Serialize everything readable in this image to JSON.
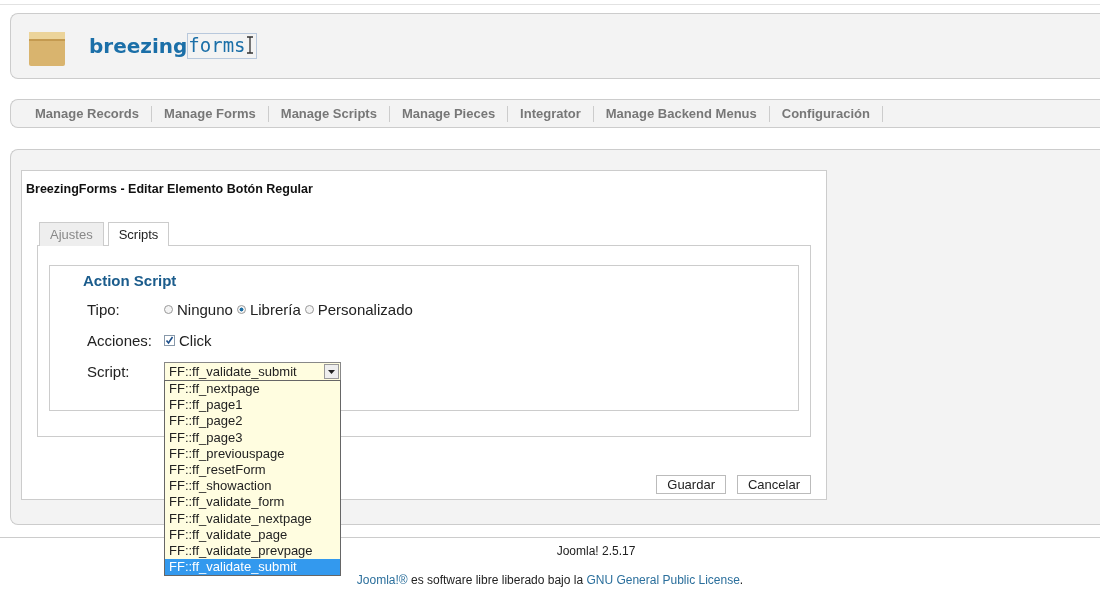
{
  "logo": {
    "bold": "breezing",
    "light": "forms"
  },
  "menu": [
    "Manage Records",
    "Manage Forms",
    "Manage Scripts",
    "Manage Pieces",
    "Integrator",
    "Manage Backend Menus",
    "Configuración"
  ],
  "card": {
    "title": "BreezingForms - Editar Elemento Botón Regular",
    "tabs": [
      {
        "label": "Ajustes",
        "selected": false
      },
      {
        "label": "Scripts",
        "selected": true
      }
    ],
    "legend": "Action Script",
    "tipo": {
      "label": "Tipo:",
      "options": [
        {
          "label": "Ninguno",
          "selected": false
        },
        {
          "label": "Librería",
          "selected": true
        },
        {
          "label": "Personalizado",
          "selected": false
        }
      ]
    },
    "acciones": {
      "label": "Acciones:",
      "items": [
        {
          "label": "Click",
          "checked": true
        }
      ]
    },
    "script": {
      "label": "Script:",
      "value": "FF::ff_validate_submit",
      "expanded": true,
      "options": [
        {
          "label": "FF::ff_nextpage",
          "selected": false
        },
        {
          "label": "FF::ff_page1",
          "selected": false
        },
        {
          "label": "FF::ff_page2",
          "selected": false
        },
        {
          "label": "FF::ff_page3",
          "selected": false
        },
        {
          "label": "FF::ff_previouspage",
          "selected": false
        },
        {
          "label": "FF::ff_resetForm",
          "selected": false
        },
        {
          "label": "FF::ff_showaction",
          "selected": false
        },
        {
          "label": "FF::ff_validate_form",
          "selected": false
        },
        {
          "label": "FF::ff_validate_nextpage",
          "selected": false
        },
        {
          "label": "FF::ff_validate_page",
          "selected": false
        },
        {
          "label": "FF::ff_validate_prevpage",
          "selected": false
        },
        {
          "label": "FF::ff_validate_submit",
          "selected": true
        }
      ]
    },
    "buttons": [
      "Guardar",
      "Cancelar"
    ]
  },
  "footer": {
    "version": "Joomla! 2.5.17",
    "license": [
      {
        "kind": "link",
        "text": "Joomla!®"
      },
      {
        "kind": "text",
        "text": " es software libre liberado bajo la "
      },
      {
        "kind": "link",
        "text": "GNU General Public License"
      },
      {
        "kind": "text",
        "text": "."
      }
    ]
  }
}
